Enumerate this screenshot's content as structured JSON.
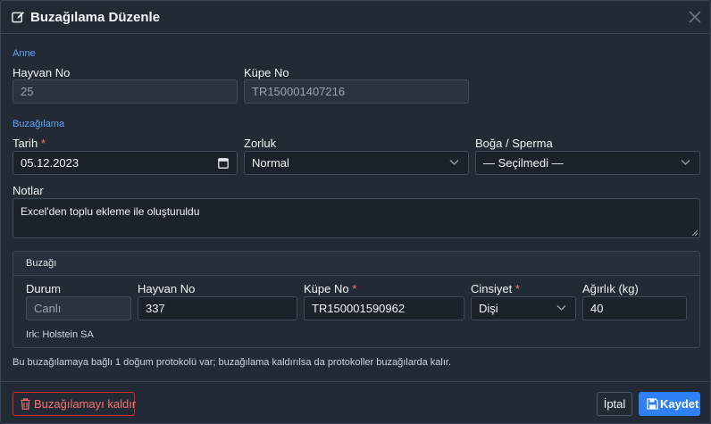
{
  "modal": {
    "title": "Buzağılama Düzenle"
  },
  "mother": {
    "section": "Anne",
    "animal_no_label": "Hayvan No",
    "animal_no_value": "25",
    "ear_tag_label": "Küpe No",
    "ear_tag_value": "TR150001407216"
  },
  "calving": {
    "section": "Buzağılama",
    "date_label": "Tarih",
    "date_value": "05.12.2023",
    "difficulty_label": "Zorluk",
    "difficulty_value": "Normal",
    "bull_label": "Boğa / Sperma",
    "bull_value": "— Seçilmedi —",
    "notes_label": "Notlar",
    "notes_value": "Excel'den toplu ekleme ile oluşturuldu",
    "required_mark": "*"
  },
  "calf": {
    "title": "Buzağı",
    "status_label": "Durum",
    "status_value": "Canlı",
    "animal_no_label": "Hayvan No",
    "animal_no_value": "337",
    "ear_tag_label": "Küpe No",
    "ear_tag_value": "TR150001590962",
    "sex_label": "Cinsiyet",
    "sex_value": "Dişi",
    "weight_label": "Ağırlık (kg)",
    "weight_value": "40",
    "breed": "Irk: Holstein SA",
    "required_mark": "*"
  },
  "info_note": "Bu buzağılamaya bağlı 1 doğum protokolü var; buzağılama kaldırılsa da protokoller buzağılarda kalır.",
  "footer": {
    "remove_label": "Buzağılamayı kaldır",
    "cancel_label": "İptal",
    "save_label": "Kaydet"
  },
  "colors": {
    "accent": "#2f7ff5",
    "danger": "#dc2626",
    "section": "#60a5fa"
  },
  "icons": {
    "title": "edit-icon",
    "close": "close-icon",
    "remove": "trash-icon",
    "save": "save-icon"
  }
}
